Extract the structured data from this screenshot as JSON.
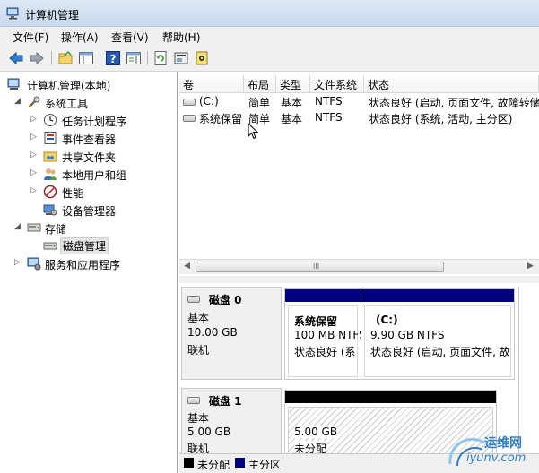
{
  "window": {
    "title": "计算机管理"
  },
  "menu": [
    "文件(F)",
    "操作(A)",
    "查看(V)",
    "帮助(H)"
  ],
  "toolbar": {
    "icons": [
      "back-icon",
      "forward-icon",
      "up-folder-icon",
      "show-tree-icon",
      "help-icon",
      "action-pane-icon",
      "refresh-icon",
      "properties-icon",
      "settings-icon"
    ]
  },
  "tree": {
    "root": "计算机管理(本地)",
    "system_tools": "系统工具",
    "task_scheduler": "任务计划程序",
    "event_viewer": "事件查看器",
    "shared_folders": "共享文件夹",
    "local_users": "本地用户和组",
    "performance": "性能",
    "device_manager": "设备管理器",
    "storage": "存储",
    "disk_management": "磁盘管理",
    "services_apps": "服务和应用程序"
  },
  "volumes": {
    "columns": [
      "卷",
      "布局",
      "类型",
      "文件系统",
      "状态"
    ],
    "rows": [
      [
        "(C:)",
        "简单",
        "基本",
        "NTFS",
        "状态良好 (启动, 页面文件, 故障转储"
      ],
      [
        "系统保留",
        "简单",
        "基本",
        "NTFS",
        "状态良好 (系统, 活动, 主分区)"
      ]
    ],
    "scroll_grip": "III"
  },
  "disks": [
    {
      "name": "磁盘 0",
      "type": "基本",
      "size": "10.00 GB",
      "status": "联机",
      "partitions": [
        {
          "name": "系统保留",
          "detail": "100 MB NTFS",
          "status": "状态良好 (系"
        },
        {
          "name": "(C:)",
          "detail": "9.90 GB NTFS",
          "status": "状态良好 (启动, 页面文件, 故"
        }
      ]
    },
    {
      "name": "磁盘 1",
      "type": "基本",
      "size": "5.00 GB",
      "status": "联机",
      "partitions": [
        {
          "name": "",
          "detail": "5.00 GB",
          "status": "未分配"
        }
      ]
    }
  ],
  "legend": {
    "unallocated": "未分配",
    "primary": "主分区"
  },
  "colors": {
    "primary_partition": "#00007f",
    "unallocated": "#000000",
    "title_bg": "#d3e2f4"
  },
  "watermark": {
    "brand_cn": "运维网",
    "brand_url": "iyunv.com"
  }
}
